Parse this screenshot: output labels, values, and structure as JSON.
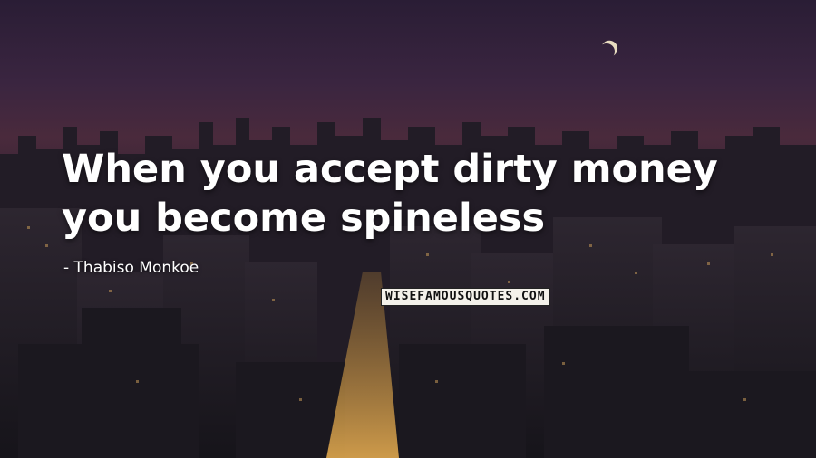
{
  "quote": {
    "text": "When you accept dirty money you become spineless",
    "author": "- Thabiso Monkoe"
  },
  "watermark": {
    "text": "WISEFAMOUSQUOTES.COM"
  },
  "colors": {
    "sky_top": "#2a1d35",
    "sky_glow": "#4a2a3c",
    "city_dark": "#15141a",
    "street_light": "#d9a24a"
  }
}
